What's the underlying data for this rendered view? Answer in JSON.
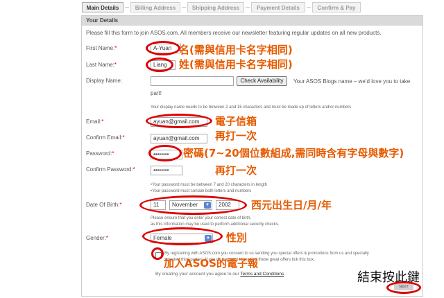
{
  "tabs": [
    {
      "label": "Main Details"
    },
    {
      "label": "Billing Address"
    },
    {
      "label": "Shipping Address"
    },
    {
      "label": "Payment Details"
    },
    {
      "label": "Confirm & Pay"
    }
  ],
  "panel_title": "Your Details",
  "intro": "Please fill this form to join ASOS.com. All members receive our newsletter featuring regular updates on all new products.",
  "required_marker": "*",
  "form": {
    "first_name": {
      "label": "First Name:",
      "value": "A-Yuan"
    },
    "last_name": {
      "label": "Last Name:",
      "value": "Liang"
    },
    "display_name": {
      "label": "Display Name:",
      "value": "",
      "button": "Check Availability",
      "note_line1": "Your ASOS Blogs name – we’d love you to take",
      "note_line2": "part!",
      "hint": "Your display name needs to be between 2 and 15 characters and must be made up of letters and/or numbers"
    },
    "email": {
      "label": "Email:",
      "value": "ayuan@gmail.com"
    },
    "confirm_email": {
      "label": "Confirm Email:",
      "value": "ayuan@gmail.com"
    },
    "password": {
      "label": "Password:",
      "value": "••••••••"
    },
    "confirm_password": {
      "label": "Confirm Password:",
      "value": "••••••••"
    },
    "password_hint1": "•Your password must be between 7 and 20 characters in length",
    "password_hint2": "•Your password must contain both letters and numbers",
    "dob": {
      "label": "Date Of Birth:",
      "day": "11",
      "month": "November",
      "year": "2002"
    },
    "dob_hint1": "Please ensure that you enter your correct date of birth,",
    "dob_hint2": "as this information may be used to perform additional security checks.",
    "gender": {
      "label": "Gender:",
      "value": "Female"
    },
    "consent1": "By registering with ASOS.com you consent to us sending you special offers & promotions from us and specially",
    "consent2": "selected third parties. If you do not want to receive these great offers tick this box.",
    "terms_prefix": "By creating your account you agree to our",
    "terms_link": "Terms and Conditions",
    "next_button": "NEXT"
  },
  "annotations": {
    "first_name": "名(需與信用卡名字相同)",
    "last_name": "姓(需與信用卡名字相同)",
    "email": "電子信箱",
    "confirm_email": "再打一次",
    "password": "密碼(7~20個位數組成,需同時含有字母與數字)",
    "confirm_password": "再打一次",
    "dob": "西元出生日/月/年",
    "gender": "性別",
    "newsletter": "加入ASOS的電子報",
    "finish": "結束按此鍵"
  },
  "colors": {
    "annotation": "#e65a00",
    "ring": "#dd0000",
    "select_arrow": "#5c87d3"
  }
}
